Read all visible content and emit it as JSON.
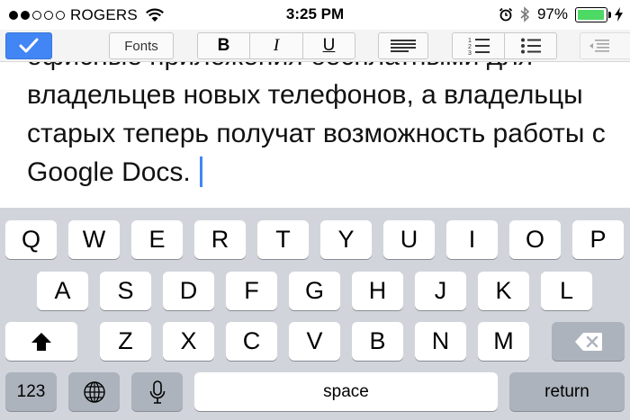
{
  "status_bar": {
    "carrier": "ROGERS",
    "time": "3:25 PM",
    "battery": "97%",
    "battery_level": 0.97,
    "signal_bars": 2,
    "icons": [
      "wifi-icon",
      "alarm-icon",
      "bluetooth-icon",
      "battery-icon",
      "charging-icon"
    ]
  },
  "toolbar": {
    "fonts_label": "Fonts",
    "bold_label": "B",
    "italic_label": "I",
    "underline_label": "U",
    "icons": [
      "checkmark-icon",
      "align-left-icon",
      "numbered-list-icon",
      "bulleted-list-icon",
      "outdent-icon"
    ],
    "accent_color": "#4285f4"
  },
  "document": {
    "lines": [
      "офисные приложения бесплатными для",
      "владельцев новых телефонов, а владельцы",
      "старых теперь получат возможность работы с",
      "Google Docs."
    ]
  },
  "keyboard": {
    "row1": [
      "Q",
      "W",
      "E",
      "R",
      "T",
      "Y",
      "U",
      "I",
      "O",
      "P"
    ],
    "row2": [
      "A",
      "S",
      "D",
      "F",
      "G",
      "H",
      "J",
      "K",
      "L"
    ],
    "row3": [
      "Z",
      "X",
      "C",
      "V",
      "B",
      "N",
      "M"
    ],
    "numbers_label": "123",
    "space_label": "space",
    "return_label": "return",
    "icons": [
      "shift-icon",
      "delete-icon",
      "globe-icon",
      "microphone-icon"
    ]
  }
}
